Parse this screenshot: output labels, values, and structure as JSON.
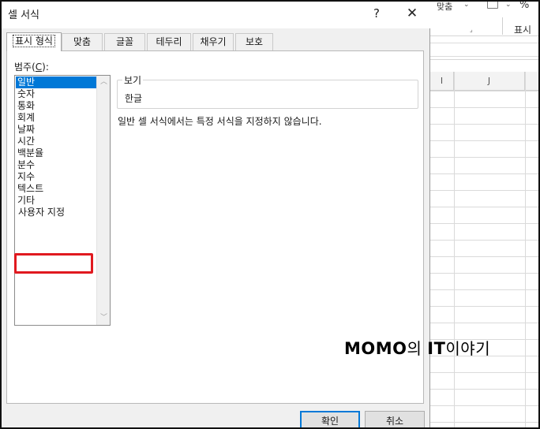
{
  "dialog": {
    "title": "셀 서식",
    "help_glyph": "?",
    "close_glyph": "✕",
    "tabs": [
      {
        "label": "표시 형식",
        "active": true
      },
      {
        "label": "맞춤",
        "active": false
      },
      {
        "label": "글꼴",
        "active": false
      },
      {
        "label": "테두리",
        "active": false
      },
      {
        "label": "채우기",
        "active": false
      },
      {
        "label": "보호",
        "active": false
      }
    ],
    "category_label": "범주(",
    "category_label_key": "C",
    "category_label_end": "):",
    "categories": [
      "일반",
      "숫자",
      "통화",
      "회계",
      "날짜",
      "시간",
      "백분율",
      "분수",
      "지수",
      "텍스트",
      "기타",
      "사용자 지정"
    ],
    "selected_category": "일반",
    "sample": {
      "legend": "보기",
      "value": "한글"
    },
    "description": "일반 셀 서식에서는 특정 서식을 지정하지 않습니다.",
    "ok_label": "확인",
    "cancel_label": "취소"
  },
  "spreadsheet": {
    "ribbon_align_label": "맞춤",
    "ribbon_number_label": "표시",
    "ribbon_percent": "%",
    "columns": [
      "I",
      "J"
    ]
  },
  "watermark": {
    "brand": "MOMO",
    "middle": "의 ",
    "brand2": "IT",
    "tail": "이야기"
  },
  "colors": {
    "selection": "#0078d7",
    "highlight_box": "#e0191f",
    "dialog_bg": "#f0f0f0"
  }
}
